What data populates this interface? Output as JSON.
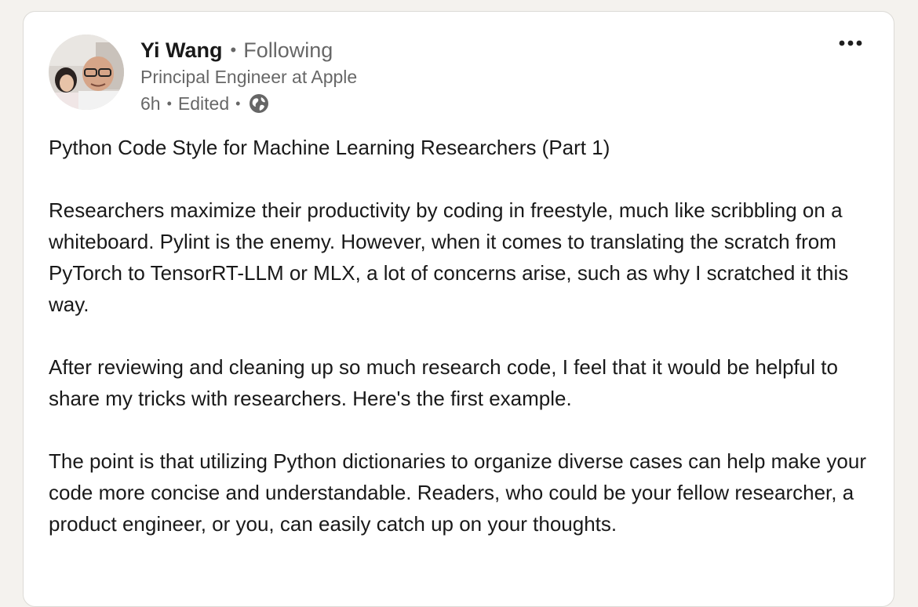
{
  "post": {
    "author": {
      "name": "Yi Wang",
      "separator": "•",
      "follow_status": "Following",
      "headline": "Principal Engineer at Apple"
    },
    "meta": {
      "time": "6h",
      "separator": "•",
      "edited": "Edited",
      "visibility_icon": "globe-icon"
    },
    "more_icon": "more-horizontal-icon",
    "title": "Python Code Style for Machine Learning Researchers (Part 1)",
    "paragraphs": [
      "Researchers maximize their productivity by coding in freestyle, much like scribbling on a whiteboard. Pylint is the enemy. However, when it comes to translating the scratch from PyTorch to TensorRT-LLM or MLX, a lot of concerns arise, such as why I scratched it this way.",
      "After reviewing and cleaning up so much research code, I feel that it would be helpful to share my tricks with researchers. Here's the first example.",
      "The point is that utilizing Python dictionaries to organize diverse cases can help make your code more concise and understandable. Readers, who could be your fellow researcher, a product engineer, or you, can easily catch up on your thoughts."
    ]
  },
  "colors": {
    "page_background": "#f4f2ee",
    "card_background": "#ffffff",
    "primary_text": "rgba(0,0,0,0.9)",
    "secondary_text": "rgba(0,0,0,0.6)"
  }
}
